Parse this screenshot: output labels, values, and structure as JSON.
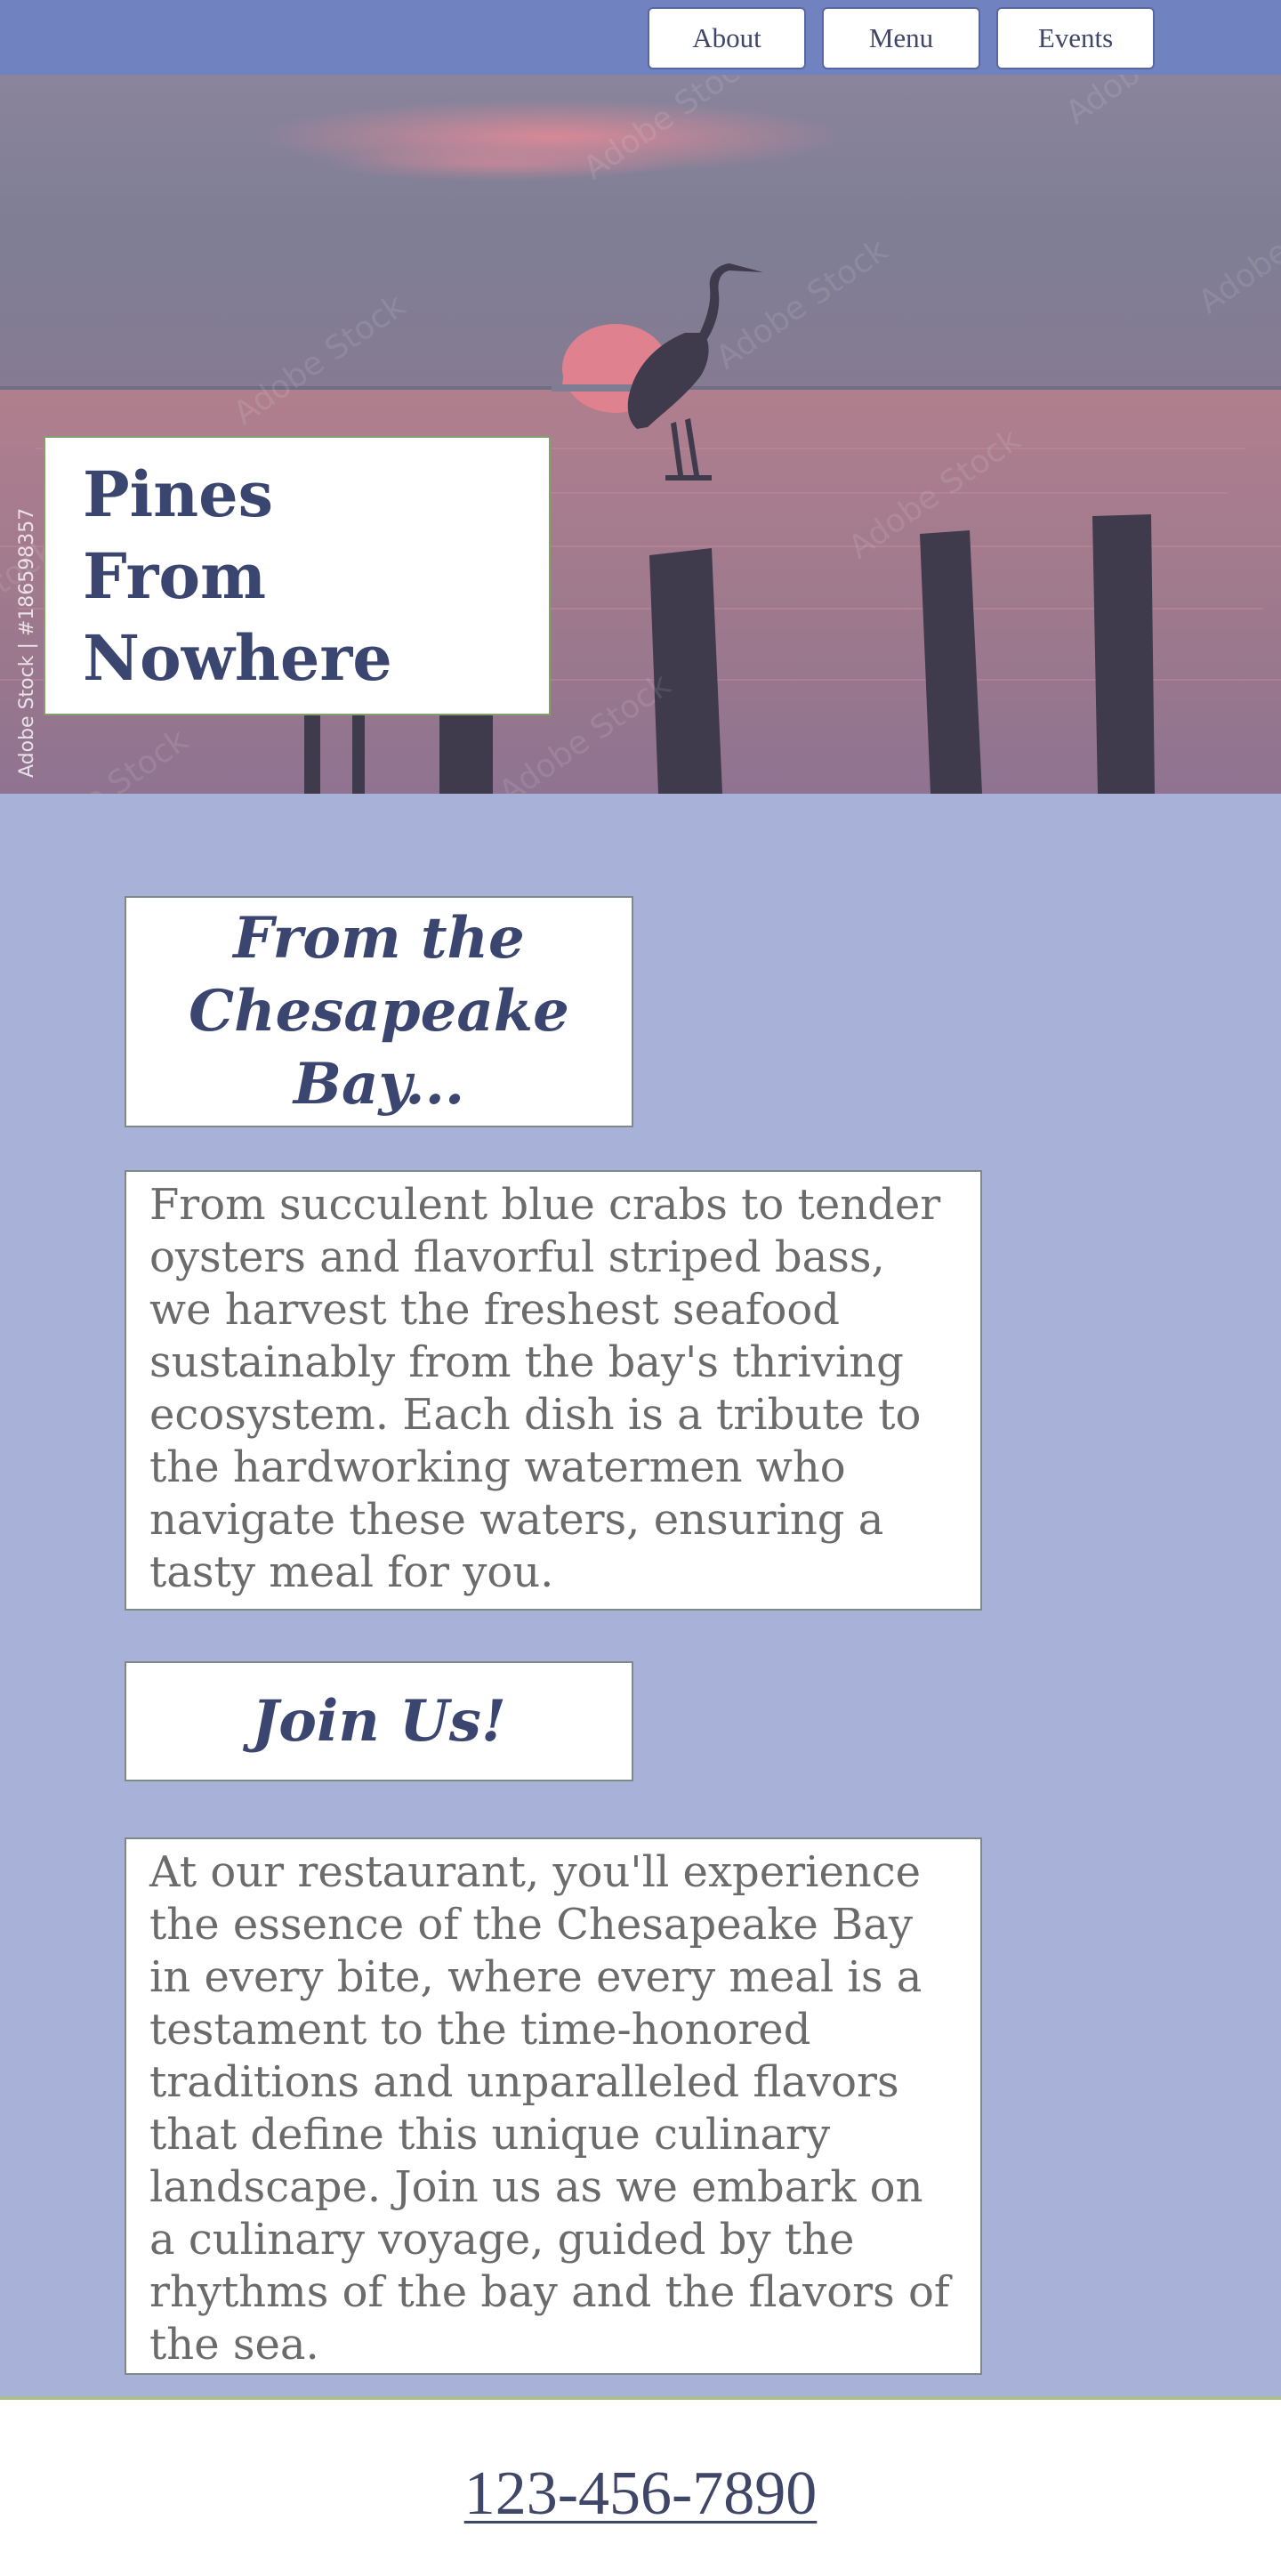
{
  "nav": {
    "items": [
      {
        "label": "About"
      },
      {
        "label": "Menu"
      },
      {
        "label": "Events"
      }
    ]
  },
  "hero": {
    "title": "Pines From Nowhere",
    "watermark": "Adobe Stock | #186598357",
    "image": "sunset-heron-on-pier-piling",
    "overlay_text": "Adobe Stock"
  },
  "sections": [
    {
      "heading": "From the Chesapeake Bay...",
      "body": "From succulent blue crabs to tender oysters and flavorful striped bass, we harvest the freshest seafood sustainably from the bay's thriving ecosystem. Each dish is a tribute to the hardworking watermen who navigate these waters, ensuring a tasty meal for you."
    },
    {
      "heading": "Join Us!",
      "body": "At our restaurant, you'll experience the essence of the Chesapeake Bay in every bite, where every meal is a testament to the time-honored traditions and unparalleled flavors that define this unique culinary landscape. Join us as we embark on a culinary voyage, guided by the rhythms of the bay and the flavors of the sea."
    }
  ],
  "footer": {
    "phone": "123-456-7890"
  },
  "colors": {
    "nav_bg": "#7182c0",
    "page_bg": "#a8b2d8",
    "heading": "#3a4670",
    "body_text": "#6b6b6b"
  }
}
